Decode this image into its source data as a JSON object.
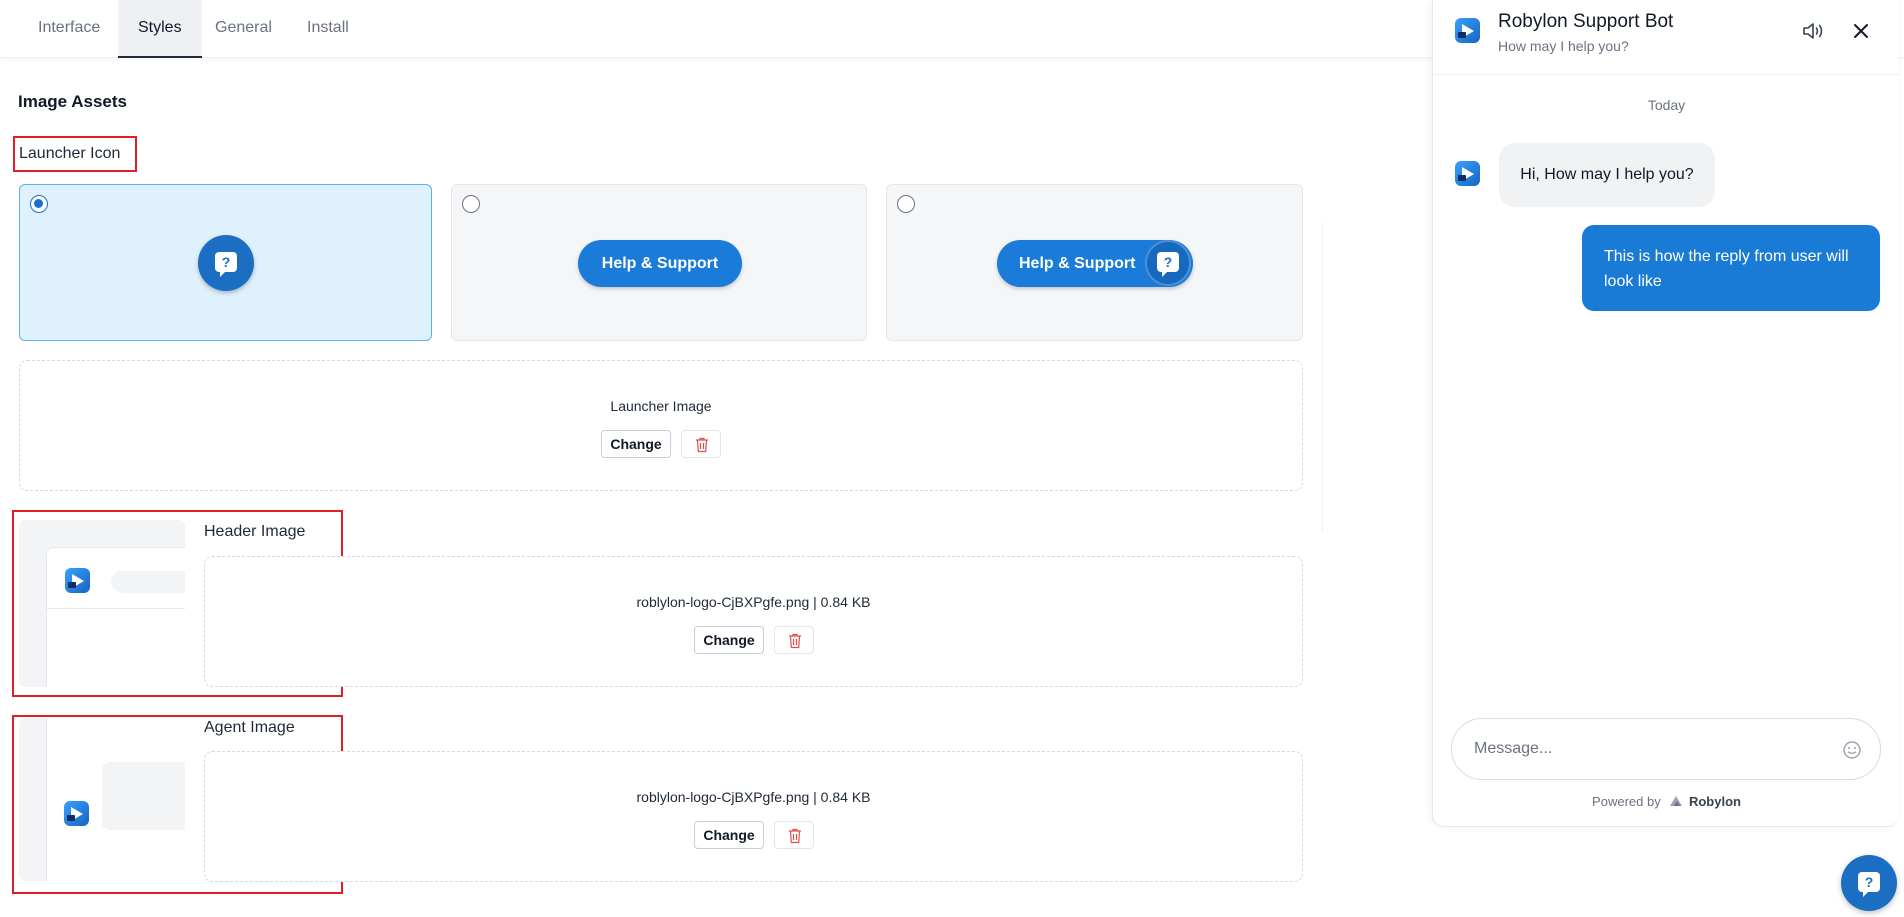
{
  "tabs": [
    {
      "label": "Interface"
    },
    {
      "label": "Styles",
      "active": true
    },
    {
      "label": "General"
    },
    {
      "label": "Install"
    }
  ],
  "section": {
    "title": "Image Assets"
  },
  "launcher_icon": {
    "label": "Launcher Icon",
    "options": [
      {
        "type": "icon",
        "selected": true
      },
      {
        "type": "pill",
        "text": "Help & Support",
        "selected": false
      },
      {
        "type": "pill-with-icon",
        "text": "Help & Support",
        "selected": false
      }
    ],
    "image_label": "Launcher Image",
    "change_label": "Change"
  },
  "header_image": {
    "label": "Header Image",
    "file": "roblylon-logo-CjBXPgfe.png | 0.84 KB",
    "change_label": "Change"
  },
  "agent_image": {
    "label": "Agent Image",
    "file": "roblylon-logo-CjBXPgfe.png | 0.84 KB",
    "change_label": "Change"
  },
  "chat": {
    "title": "Robylon Support Bot",
    "subtitle": "How may I help you?",
    "date_divider": "Today",
    "bot_message": "Hi, How may I help you?",
    "user_message": "This is how the reply from user will look like",
    "input_placeholder": "Message...",
    "powered_by": "Powered by",
    "brand": "Robylon"
  },
  "colors": {
    "accent": "#1b7bd8",
    "highlight_box": "#e11d2a",
    "selected_bg": "#dff1fc"
  },
  "icons": [
    "speaker-icon",
    "close-icon",
    "emoji-icon",
    "trash-icon",
    "question-bubble-icon",
    "robylon-logo-icon"
  ]
}
